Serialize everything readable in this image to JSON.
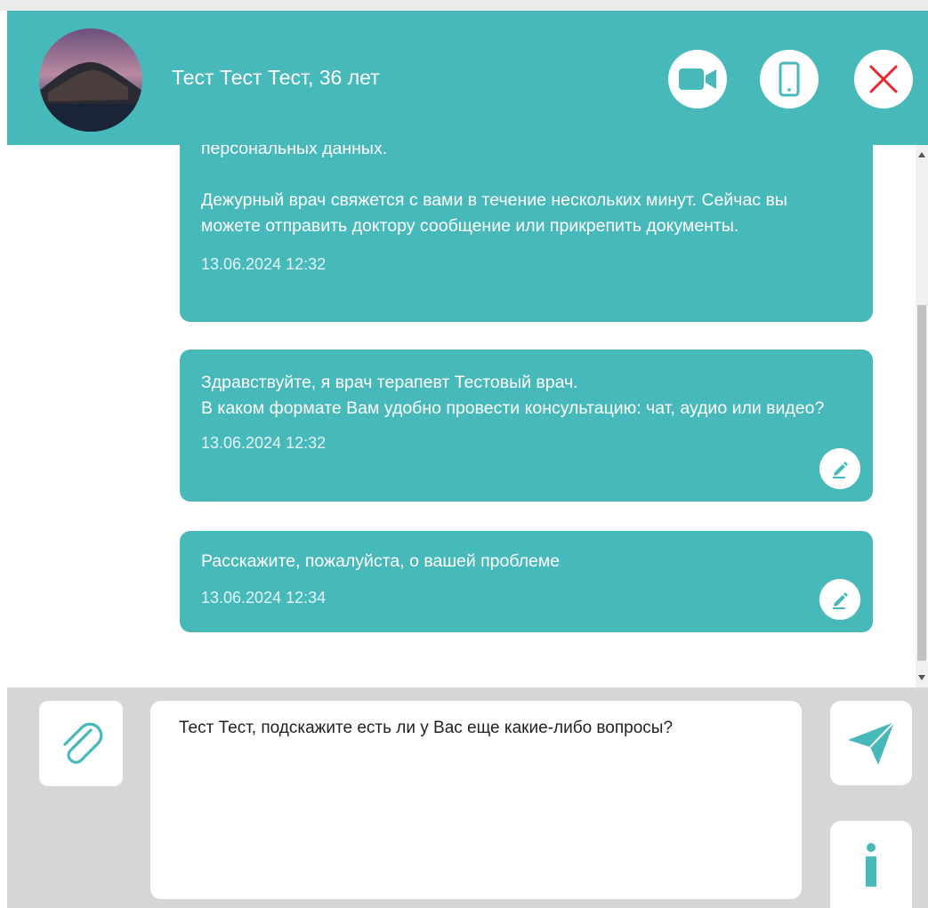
{
  "header": {
    "patient_name": "Тест Тест Тест, 36 лет",
    "video_icon": "video-camera-icon",
    "phone_icon": "phone-icon",
    "close_icon": "close-icon"
  },
  "messages": [
    {
      "text_1": "персональных данных.",
      "text_2": "Дежурный врач свяжется с вами в течение нескольких минут. Сейчас вы можете отправить доктору сообщение или прикрепить документы.",
      "time": "13.06.2024 12:32",
      "editable": false
    },
    {
      "text": "Здравствуйте, я врач терапевт Тестовый врач.\nВ каком формате Вам удобно провести консультацию: чат, аудио или видео?",
      "time": "13.06.2024 12:32",
      "editable": true
    },
    {
      "text": "Расскажите, пожалуйста, о вашей проблеме",
      "time": "13.06.2024 12:34",
      "editable": true
    }
  ],
  "composer": {
    "input_value": "Тест Тест, подскажите есть ли у Вас еще какие-либо вопросы?",
    "attach_icon": "paperclip-icon",
    "send_icon": "send-icon",
    "info_icon": "info-icon"
  },
  "colors": {
    "accent": "#47b9bb",
    "close_red": "#e8262b",
    "composer_bg": "#d6d6d6"
  }
}
